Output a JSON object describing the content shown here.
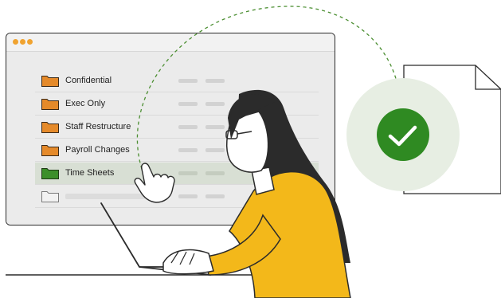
{
  "window": {
    "dots": [
      {
        "name": "window-dot-1",
        "color": "#f0a330"
      },
      {
        "name": "window-dot-2",
        "color": "#f0a330"
      },
      {
        "name": "window-dot-3",
        "color": "#f0a330"
      }
    ]
  },
  "folders": [
    {
      "label": "Confidential",
      "icon": "folder-icon",
      "color": "#e58a2a",
      "selected": false
    },
    {
      "label": "Exec Only",
      "icon": "folder-icon",
      "color": "#e58a2a",
      "selected": false
    },
    {
      "label": "Staff Restructure",
      "icon": "folder-icon",
      "color": "#e58a2a",
      "selected": false
    },
    {
      "label": "Payroll Changes",
      "icon": "folder-icon",
      "color": "#e58a2a",
      "selected": false
    },
    {
      "label": "Time Sheets",
      "icon": "folder-icon",
      "color": "#3c8f2a",
      "selected": true
    },
    {
      "label": "",
      "icon": "empty-folder-icon",
      "color": "#f2f2f2",
      "selected": false
    }
  ],
  "illustration": {
    "check_badge_color": "#2f8a22",
    "check_halo_color": "#e7eee3",
    "accent_color": "#f3b81a",
    "dashed_path_color": "#4c8f32",
    "icons": [
      "document-icon",
      "checkmark-icon",
      "pointer-hand-icon",
      "laptop-icon",
      "woman-illustration"
    ]
  }
}
